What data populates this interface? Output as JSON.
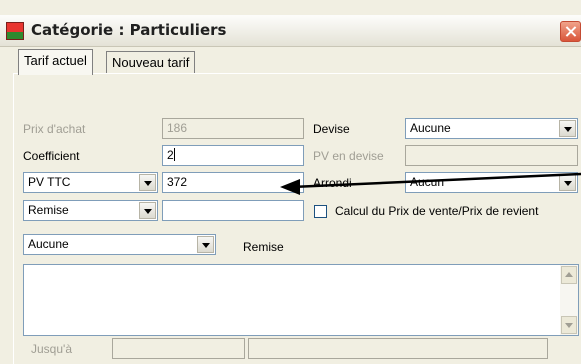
{
  "window": {
    "title": "Catégorie : Particuliers",
    "icon": "app-icon"
  },
  "tabs": [
    {
      "label": "Tarif actuel"
    },
    {
      "label": "Nouveau tarif"
    }
  ],
  "form": {
    "prix_achat_label": "Prix d'achat",
    "prix_achat_value": "186",
    "coefficient_label": "Coefficient",
    "coefficient_value": "2",
    "pv_type_selected": "PV TTC",
    "pv_value": "372",
    "remise_type_selected": "Remise",
    "remise_value": "",
    "devise_label": "Devise",
    "devise_selected": "Aucune",
    "pv_devise_label": "PV en devise",
    "pv_devise_value": "",
    "arrondi_label": "Arrondi",
    "arrondi_selected": "Aucun",
    "calcul_checkbox_label": "Calcul du Prix de vente/Prix de revient",
    "calcul_checked": false,
    "remise_mode_selected": "Aucune",
    "remise_label": "Remise",
    "jusqua_label": "Jusqu'à",
    "jusqua_value_1": "",
    "jusqua_value_2": ""
  },
  "annotation": {
    "color": "#000000",
    "icon": "callout-arrow"
  }
}
